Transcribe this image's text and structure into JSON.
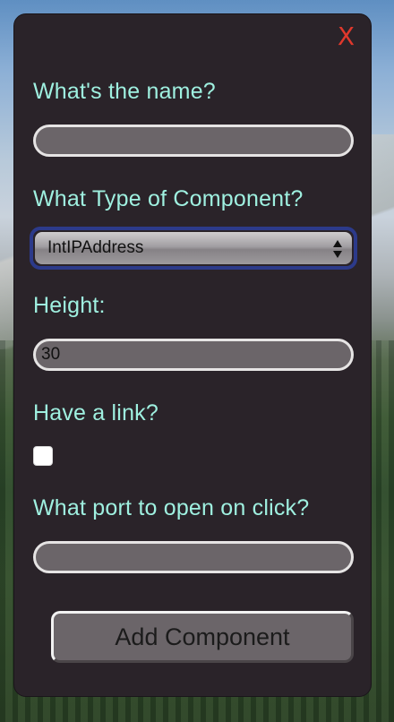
{
  "dialog": {
    "close_label": "X",
    "name_label": "What's the name?",
    "name_value": "",
    "type_label": "What Type of Component?",
    "type_selected": "IntIPAddress",
    "height_label": "Height:",
    "height_value": "30",
    "link_label": "Have a link?",
    "link_checked": false,
    "port_label": "What port to open on click?",
    "port_value": "",
    "add_button_label": "Add Component"
  },
  "colors": {
    "panel_background": "#2a2329",
    "label_text": "#9ff0e0",
    "close_icon": "#e0382c",
    "select_focus_border": "#2c3a8a",
    "input_fill": "#6b6569"
  }
}
